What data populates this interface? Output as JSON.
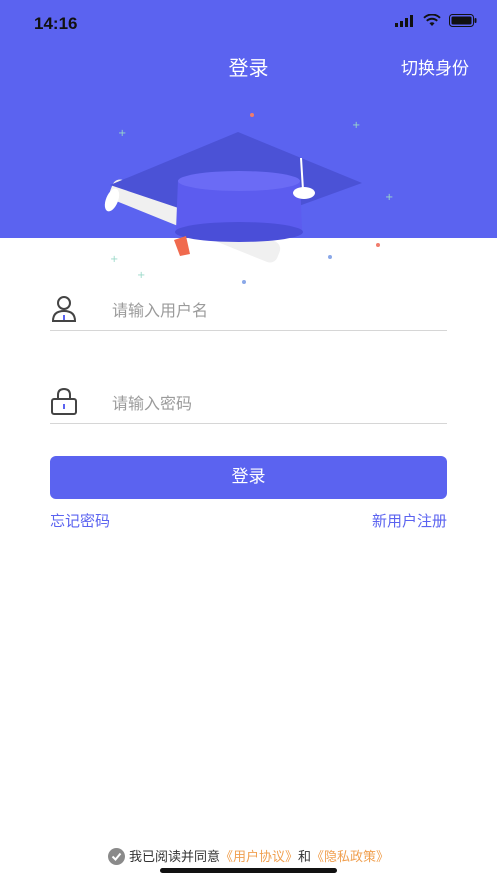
{
  "status_bar": {
    "time": "14:16"
  },
  "header": {
    "title": "登录",
    "switch_role": "切换身份"
  },
  "form": {
    "username_placeholder": "请输入用户名",
    "password_placeholder": "请输入密码",
    "login_button": "登录",
    "forgot_password": "忘记密码",
    "register": "新用户注册"
  },
  "agreement": {
    "prefix": "我已阅读并同意",
    "user_agreement": "《用户协议》",
    "and": "和",
    "privacy_policy": "《隐私政策》"
  },
  "colors": {
    "primary": "#5b63f0",
    "link_orange": "#f0a050"
  }
}
